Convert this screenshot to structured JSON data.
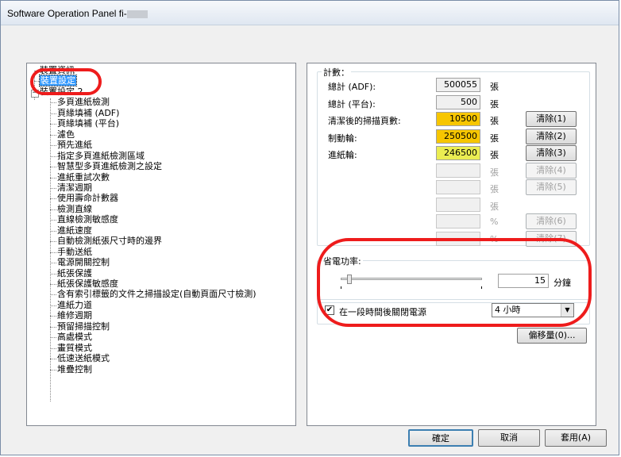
{
  "window": {
    "title": "Software Operation Panel fi-"
  },
  "tree": {
    "items": [
      "裝置資訊",
      "裝置設定",
      "裝置設定 2",
      "多頁進紙檢測",
      "頁緣填補 (ADF)",
      "頁緣填補 (平台)",
      "濾色",
      "預先進紙",
      "指定多頁進紙檢測區域",
      "智慧型多頁進紙檢測之設定",
      "進紙重試次數",
      "清潔週期",
      "使用壽命計數器",
      "檢測直線",
      "直線檢測敏感度",
      "進紙速度",
      "自動檢測紙張尺寸時的邊界",
      "手動送紙",
      "電源開關控制",
      "紙張保護",
      "紙張保護敏感度",
      "含有索引標籤的文件之掃描設定(自動頁面尺寸檢測)",
      "進紙力道",
      "維修週期",
      "預留掃描控制",
      "高處模式",
      "畫質模式",
      "低速送紙模式",
      "堆疊控制"
    ],
    "selected_index": 1
  },
  "counters": {
    "group_label": "計數：",
    "rows": [
      {
        "label": "總計 (ADF):",
        "value": "500055",
        "unit": "張",
        "button": ""
      },
      {
        "label": "總計 (平台):",
        "value": "500",
        "unit": "張",
        "button": ""
      },
      {
        "label": "清潔後的掃描頁數:",
        "value": "10500",
        "unit": "張",
        "button": "清除(1)"
      },
      {
        "label": "制動輪:",
        "value": "250500",
        "unit": "張",
        "button": "清除(2)"
      },
      {
        "label": "進紙輪:",
        "value": "246500",
        "unit": "張",
        "button": "清除(3)"
      },
      {
        "label": "",
        "value": "",
        "unit": "張",
        "button": "清除(4)"
      },
      {
        "label": "",
        "value": "",
        "unit": "張",
        "button": "清除(5)"
      },
      {
        "label": "",
        "value": "",
        "unit": "張",
        "button": ""
      },
      {
        "label": "",
        "value": "",
        "unit": "%",
        "button": "清除(6)"
      },
      {
        "label": "",
        "value": "",
        "unit": "%",
        "button": "清除(7)"
      }
    ],
    "highlight_colors": {
      "strong": "#f7c600",
      "light": "#ebed52"
    }
  },
  "power_saving": {
    "group_label": "省電功率:",
    "minutes_value": "15",
    "minutes_unit": "分鐘",
    "slider_fraction": 0.06,
    "auto_off_checked": true,
    "auto_off_label": "在一段時間後關閉電源",
    "auto_off_selected": "4 小時"
  },
  "offset_button": "偏移量(0)...",
  "footer": {
    "ok": "確定",
    "cancel": "取消",
    "apply": "套用(A)"
  },
  "annotation_color": "#ee1c1c"
}
